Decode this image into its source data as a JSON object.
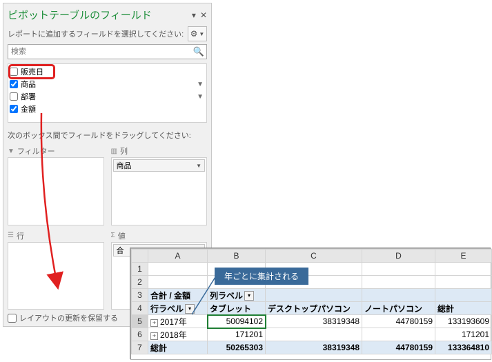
{
  "pane": {
    "title": "ピボットテーブルのフィールド",
    "subtitle": "レポートに追加するフィールドを選択してください:",
    "search_placeholder": "検索",
    "fields": [
      {
        "label": "販売日",
        "checked": false,
        "filter": false
      },
      {
        "label": "商品",
        "checked": true,
        "filter": true
      },
      {
        "label": "部署",
        "checked": false,
        "filter": true
      },
      {
        "label": "金額",
        "checked": true,
        "filter": false
      }
    ],
    "drag_hint": "次のボックス間でフィールドをドラッグしてください:",
    "areas": {
      "filters": {
        "label": "フィルター"
      },
      "columns": {
        "label": "列",
        "items": [
          "商品"
        ]
      },
      "rows": {
        "label": "行"
      },
      "values": {
        "label": "値",
        "items": [
          "合"
        ]
      }
    },
    "defer_label": "レイアウトの更新を保留する"
  },
  "callout": "年ごとに集計される",
  "sheet": {
    "col_headers": [
      "A",
      "B",
      "C",
      "D",
      "E"
    ],
    "row_numbers": [
      "1",
      "2",
      "3",
      "4",
      "5",
      "6",
      "7"
    ],
    "pivot_title": "合計 / 金額",
    "col_label": "列ラベル",
    "row_label": "行ラベル",
    "columns": [
      "タブレット",
      "デスクトップパソコン",
      "ノートパソコン",
      "総計"
    ],
    "rows": [
      {
        "label": "2017年",
        "values": [
          "50094102",
          "38319348",
          "44780159",
          "133193609"
        ]
      },
      {
        "label": "2018年",
        "values": [
          "171201",
          "",
          "",
          "171201"
        ]
      }
    ],
    "total_label": "総計",
    "totals": [
      "50265303",
      "38319348",
      "44780159",
      "133364810"
    ]
  },
  "chart_data": {
    "type": "table",
    "title": "合計 / 金額",
    "row_field": "行ラベル",
    "column_field": "列ラベル (商品)",
    "columns": [
      "タブレット",
      "デスクトップパソコン",
      "ノートパソコン"
    ],
    "rows": [
      "2017年",
      "2018年"
    ],
    "values": [
      [
        50094102,
        38319348,
        44780159
      ],
      [
        171201,
        null,
        null
      ]
    ],
    "row_totals": [
      133193609,
      171201
    ],
    "column_totals": [
      50265303,
      38319348,
      44780159
    ],
    "grand_total": 133364810
  }
}
